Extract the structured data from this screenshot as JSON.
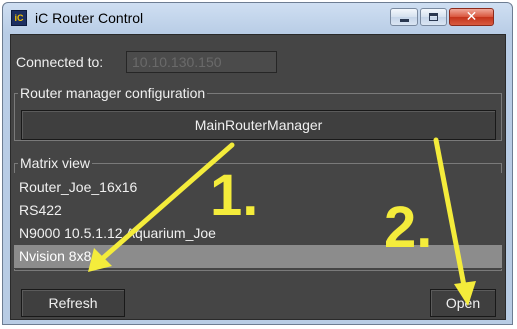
{
  "window": {
    "title": "iC Router Control",
    "app_icon_text": "iC",
    "close_glyph": "✕"
  },
  "connection": {
    "label": "Connected to:",
    "ip": "10.10.130.150"
  },
  "router_manager": {
    "legend": "Router manager configuration",
    "button_label": "MainRouterManager"
  },
  "matrix": {
    "legend": "Matrix view",
    "items": [
      {
        "label": "Router_Joe_16x16"
      },
      {
        "label": "RS422"
      },
      {
        "label": "N9000 10.5.1.12 Aquarium_Joe"
      },
      {
        "label": "Nvision 8x8",
        "selected": true
      }
    ]
  },
  "buttons": {
    "refresh": "Refresh",
    "open": "Open"
  },
  "annotations": {
    "step1": "1.",
    "step2": "2.",
    "color": "#f4ec3b"
  },
  "colors": {
    "panel": "#454545",
    "selected_row": "#8c8c8c",
    "titlebar": "#c2d4ea",
    "close_button": "#c4331b"
  }
}
